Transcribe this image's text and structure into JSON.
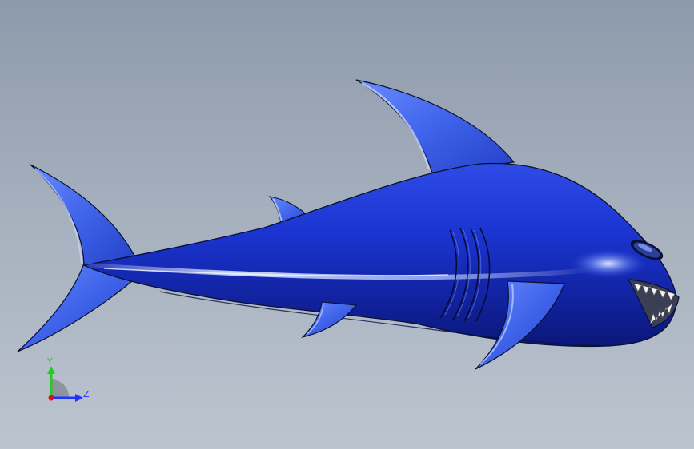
{
  "viewport": {
    "background_top": "#8d9aab",
    "background_bottom": "#bcc4cf"
  },
  "model": {
    "body_color": "#1f33c8",
    "fin_color": "#3f63ea",
    "highlight_color": "#9fb8ff",
    "outline_color": "#0a1030"
  },
  "triad": {
    "y_label": "Y",
    "z_label": "Z",
    "y_color": "#22cc22",
    "z_color": "#2233ff",
    "x_color": "#dd1111"
  }
}
